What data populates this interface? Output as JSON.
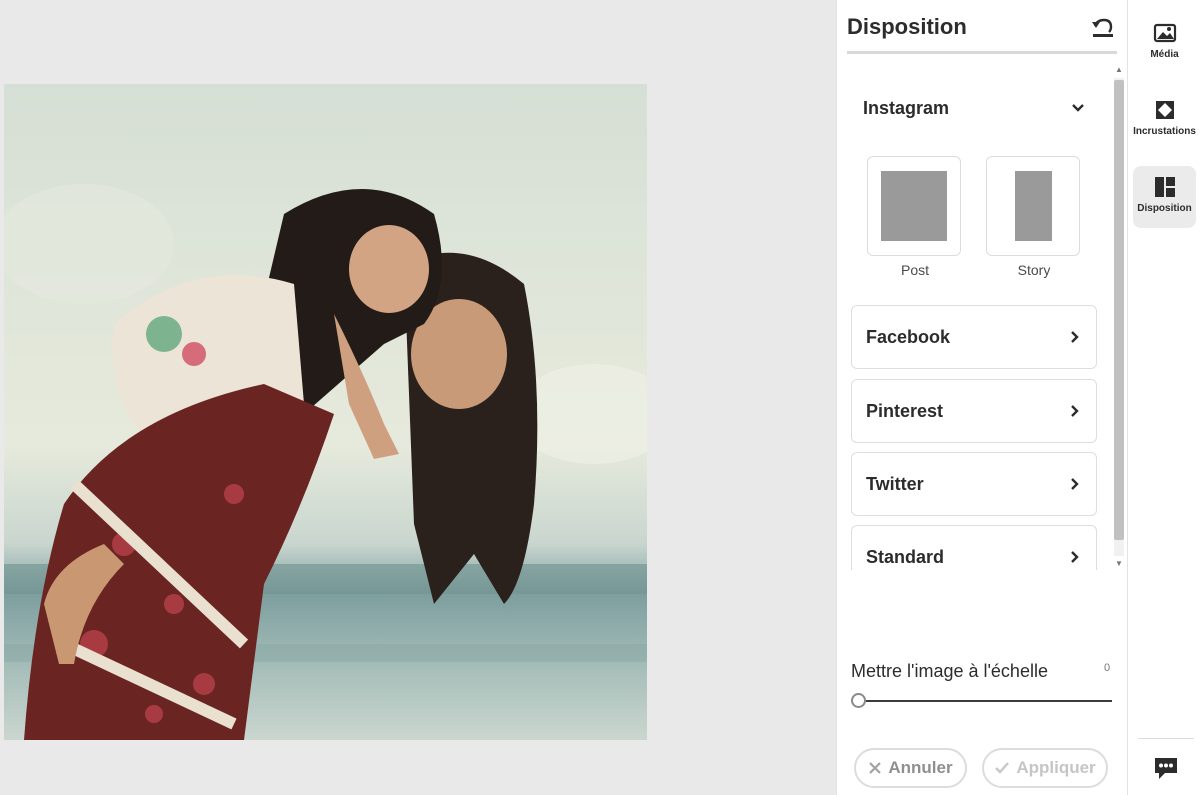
{
  "panel": {
    "title": "Disposition"
  },
  "instagram": {
    "label": "Instagram",
    "formats": [
      {
        "label": "Post"
      },
      {
        "label": "Story"
      }
    ]
  },
  "sections": [
    {
      "label": "Facebook"
    },
    {
      "label": "Pinterest"
    },
    {
      "label": "Twitter"
    },
    {
      "label": "Standard"
    }
  ],
  "scale": {
    "label": "Mettre l'image à l'échelle",
    "value": "0",
    "level": 0
  },
  "actions": {
    "cancel_label": "Annuler",
    "apply_label": "Appliquer"
  },
  "toolbar": {
    "media_label": "Média",
    "overlays_label": "Incrustations",
    "layout_label": "Disposition",
    "active": "layout"
  },
  "colors": {
    "workspace_bg": "#e9e9e9",
    "accent": "#2c2c2c",
    "format_preview": "#9a9a9a"
  }
}
